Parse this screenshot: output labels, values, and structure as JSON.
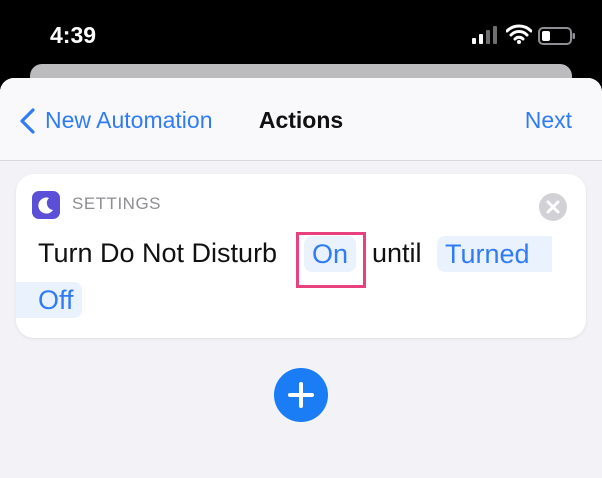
{
  "status_bar": {
    "time": "4:39"
  },
  "nav": {
    "back_label": "New Automation",
    "title": "Actions",
    "next_label": "Next"
  },
  "action_card": {
    "app_label": "SETTINGS",
    "sentence_start": "Turn Do Not Disturb",
    "state_token": "On",
    "connector": "until",
    "until_token_line1": "Turned",
    "until_token_line2": "Off"
  },
  "colors": {
    "accent": "#2f7cf6",
    "highlight": "#e8417e",
    "app_icon": "#5b4fd8"
  }
}
